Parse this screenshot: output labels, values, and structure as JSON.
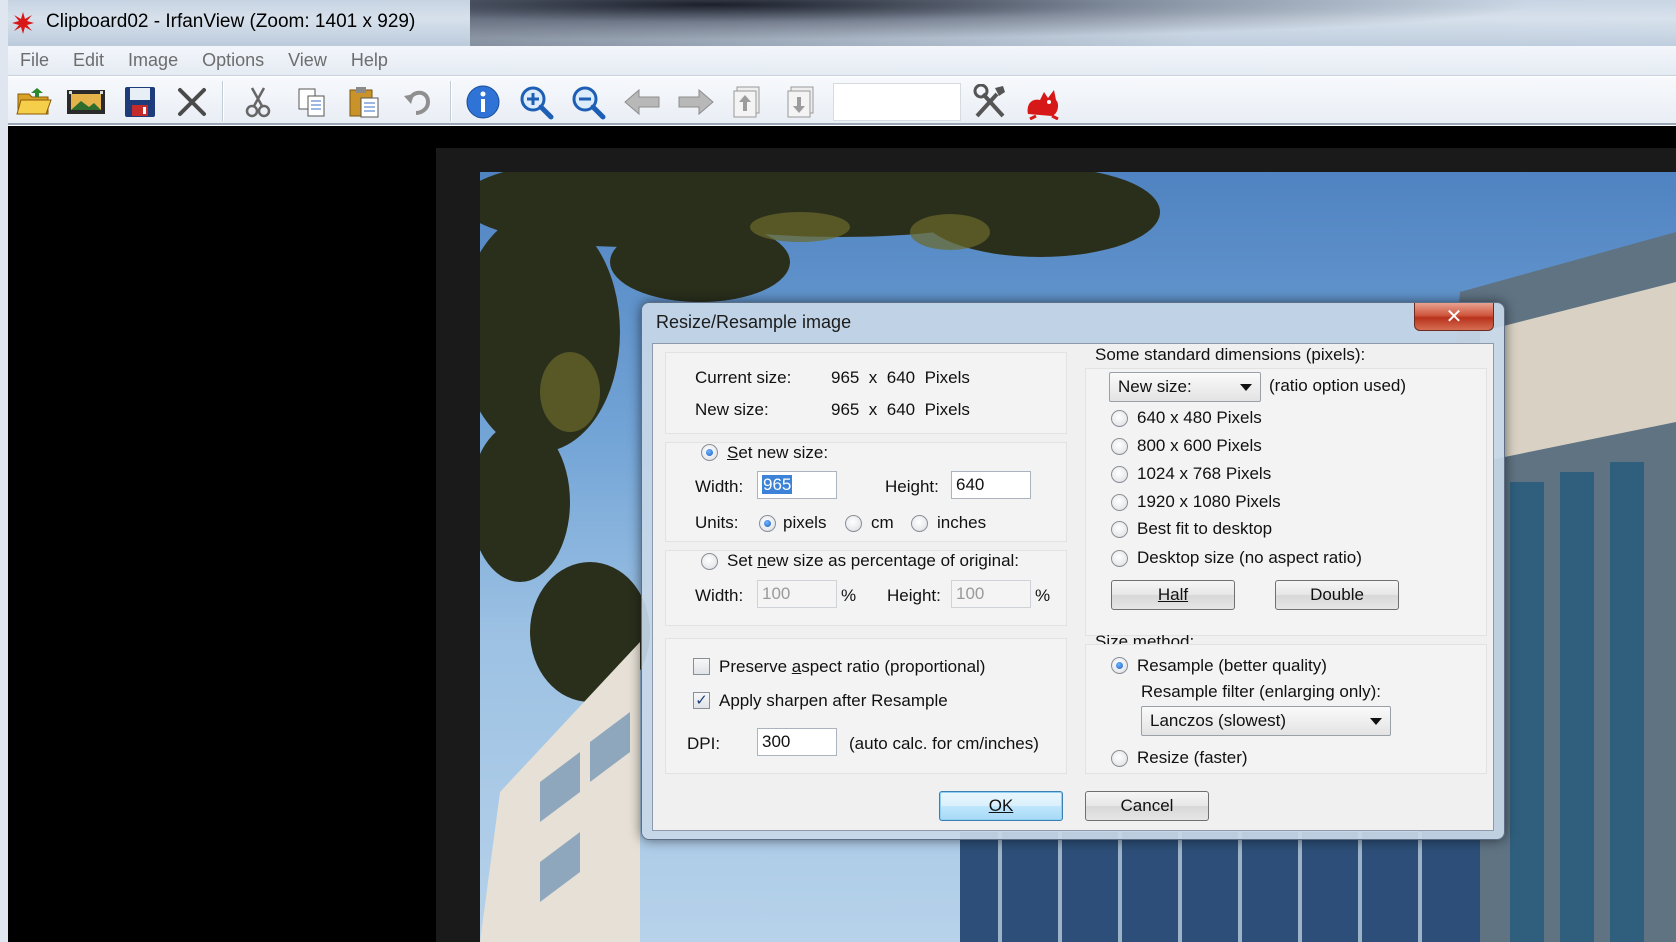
{
  "window": {
    "title": "Clipboard02 - IrfanView (Zoom: 1401 x 929)"
  },
  "menu": [
    "File",
    "Edit",
    "Image",
    "Options",
    "View",
    "Help"
  ],
  "toolbar": {
    "icons": [
      "open-folder-icon",
      "slideshow-icon",
      "save-icon",
      "delete-icon",
      "cut-icon",
      "copy-icon",
      "paste-icon",
      "undo-icon",
      "info-icon",
      "zoom-in-icon",
      "zoom-out-icon",
      "previous-icon",
      "next-icon",
      "page-up-icon",
      "page-down-icon",
      "settings-icon",
      "irfanview-cat-icon"
    ],
    "field_value": ""
  },
  "dialog": {
    "title": "Resize/Resample image",
    "close_label": "✕",
    "current_size_label": "Current size:",
    "current_size_value": "965  x  640  Pixels",
    "new_size_label": "New size:",
    "new_size_value": "965  x  640  Pixels",
    "set_new_size": {
      "label_pre": "",
      "label_u": "S",
      "label_post": "et new size:",
      "selected": true,
      "width_label": "Width:",
      "width_value": "965",
      "height_label": "Height:",
      "height_value": "640",
      "units_label": "Units:",
      "units": [
        "pixels",
        "cm",
        "inches"
      ],
      "selected_unit": "pixels"
    },
    "set_percentage": {
      "label_pre": "Set ",
      "label_u": "n",
      "label_post": "ew size as percentage of original:",
      "selected": false,
      "width_label": "Width:",
      "width_value": "100",
      "height_label": "Height:",
      "height_value": "100",
      "percent": "%"
    },
    "preserve_aspect": {
      "pre": "Preserve ",
      "u": "a",
      "post": "spect ratio (proportional)",
      "checked": false
    },
    "apply_sharpen": {
      "pre": "Apply sharpen after Resample",
      "checked": true
    },
    "dpi_label": "DPI:",
    "dpi_value": "300",
    "dpi_note": "(auto calc. for cm/inches)",
    "standard_dims": {
      "header": "Some standard dimensions (pixels):",
      "combo_value": "New size:",
      "combo_note": "(ratio option used)",
      "options": [
        "640 x 480 Pixels",
        "800 x 600 Pixels",
        "1024 x 768 Pixels",
        "1920 x 1080 Pixels",
        "Best fit to desktop",
        "Desktop size (no aspect ratio)"
      ],
      "half_label": "Half",
      "double_label": "Double"
    },
    "size_method": {
      "header": "Size method:",
      "resample_label": "Resample (better quality)",
      "resample_selected": true,
      "filter_label": "Resample filter (enlarging only):",
      "filter_value": "Lanczos (slowest)",
      "resize_label": "Resize (faster)",
      "resize_selected": false
    },
    "ok_label": "OK",
    "cancel_label": "Cancel"
  },
  "colors": {
    "accent": "#3c82d8",
    "close_button": "#c8452d",
    "dialog_frame": "#c8d8e8"
  }
}
